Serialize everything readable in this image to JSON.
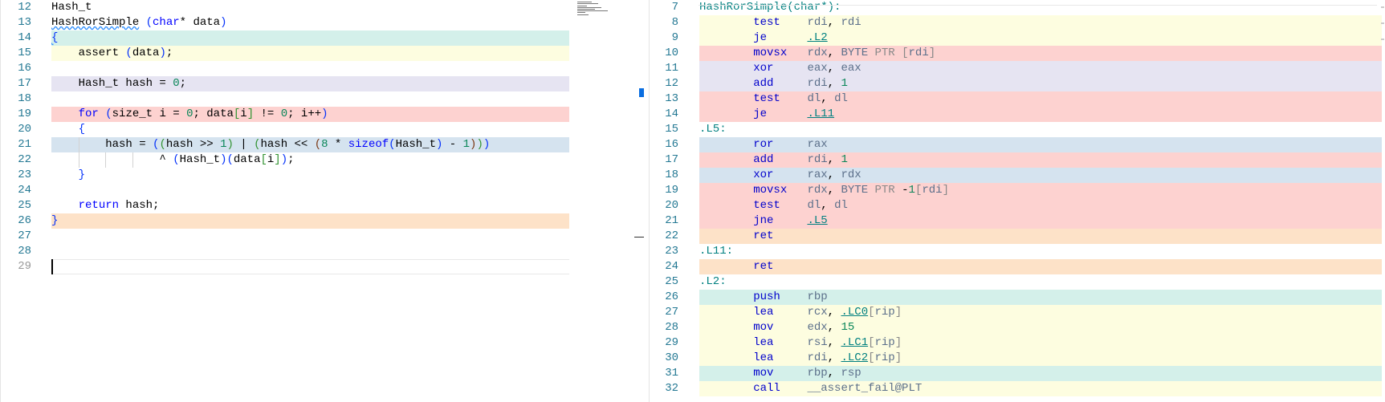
{
  "colors": {
    "teal": "#d4f0ea",
    "yellow": "#fdfde0",
    "lavender": "#e6e4f2",
    "red": "#fdd2d0",
    "blue": "#d5e3ef",
    "orange": "#fde2c8",
    "current": "#ffffff"
  },
  "source": {
    "lines": [
      {
        "num": "12",
        "text": "Hash_t",
        "bg": ""
      },
      {
        "num": "13",
        "text": "HashRorSimple (char* data)",
        "bg": ""
      },
      {
        "num": "14",
        "text": "{",
        "bg": "teal"
      },
      {
        "num": "15",
        "text": "    assert (data);",
        "bg": "yellow"
      },
      {
        "num": "16",
        "text": "",
        "bg": ""
      },
      {
        "num": "17",
        "text": "    Hash_t hash = 0;",
        "bg": "lavender"
      },
      {
        "num": "18",
        "text": "",
        "bg": ""
      },
      {
        "num": "19",
        "text": "    for (size_t i = 0; data[i] != 0; i++)",
        "bg": "red"
      },
      {
        "num": "20",
        "text": "    {",
        "bg": ""
      },
      {
        "num": "21",
        "text": "        hash = ((hash >> 1) | (hash << (8 * sizeof(Hash_t) - 1)))",
        "bg": "blue"
      },
      {
        "num": "22",
        "text": "                ^ (Hash_t)(data[i]);",
        "bg": ""
      },
      {
        "num": "23",
        "text": "    }",
        "bg": ""
      },
      {
        "num": "24",
        "text": "",
        "bg": ""
      },
      {
        "num": "25",
        "text": "    return hash;",
        "bg": ""
      },
      {
        "num": "26",
        "text": "}",
        "bg": "orange"
      },
      {
        "num": "27",
        "text": "",
        "bg": ""
      },
      {
        "num": "28",
        "text": "",
        "bg": ""
      },
      {
        "num": "29",
        "text": "",
        "bg": "current"
      }
    ]
  },
  "assembly": {
    "lines": [
      {
        "num": "7",
        "text": "HashRorSimple(char*):",
        "bg": ""
      },
      {
        "num": "8",
        "text": "        test    rdi, rdi",
        "bg": "yellow"
      },
      {
        "num": "9",
        "text": "        je      .L2",
        "bg": "yellow"
      },
      {
        "num": "10",
        "text": "        movsx   rdx, BYTE PTR [rdi]",
        "bg": "red"
      },
      {
        "num": "11",
        "text": "        xor     eax, eax",
        "bg": "lavender"
      },
      {
        "num": "12",
        "text": "        add     rdi, 1",
        "bg": "lavender"
      },
      {
        "num": "13",
        "text": "        test    dl, dl",
        "bg": "red"
      },
      {
        "num": "14",
        "text": "        je      .L11",
        "bg": "red"
      },
      {
        "num": "15",
        "text": ".L5:",
        "bg": ""
      },
      {
        "num": "16",
        "text": "        ror     rax",
        "bg": "blue"
      },
      {
        "num": "17",
        "text": "        add     rdi, 1",
        "bg": "red"
      },
      {
        "num": "18",
        "text": "        xor     rax, rdx",
        "bg": "blue"
      },
      {
        "num": "19",
        "text": "        movsx   rdx, BYTE PTR -1[rdi]",
        "bg": "red"
      },
      {
        "num": "20",
        "text": "        test    dl, dl",
        "bg": "red"
      },
      {
        "num": "21",
        "text": "        jne     .L5",
        "bg": "red"
      },
      {
        "num": "22",
        "text": "        ret",
        "bg": "orange"
      },
      {
        "num": "23",
        "text": ".L11:",
        "bg": ""
      },
      {
        "num": "24",
        "text": "        ret",
        "bg": "orange"
      },
      {
        "num": "25",
        "text": ".L2:",
        "bg": ""
      },
      {
        "num": "26",
        "text": "        push    rbp",
        "bg": "teal"
      },
      {
        "num": "27",
        "text": "        lea     rcx, .LC0[rip]",
        "bg": "yellow"
      },
      {
        "num": "28",
        "text": "        mov     edx, 15",
        "bg": "yellow"
      },
      {
        "num": "29",
        "text": "        lea     rsi, .LC1[rip]",
        "bg": "yellow"
      },
      {
        "num": "30",
        "text": "        lea     rdi, .LC2[rip]",
        "bg": "yellow"
      },
      {
        "num": "31",
        "text": "        mov     rbp, rsp",
        "bg": "teal"
      },
      {
        "num": "32",
        "text": "        call    __assert_fail@PLT",
        "bg": "yellow"
      }
    ]
  }
}
